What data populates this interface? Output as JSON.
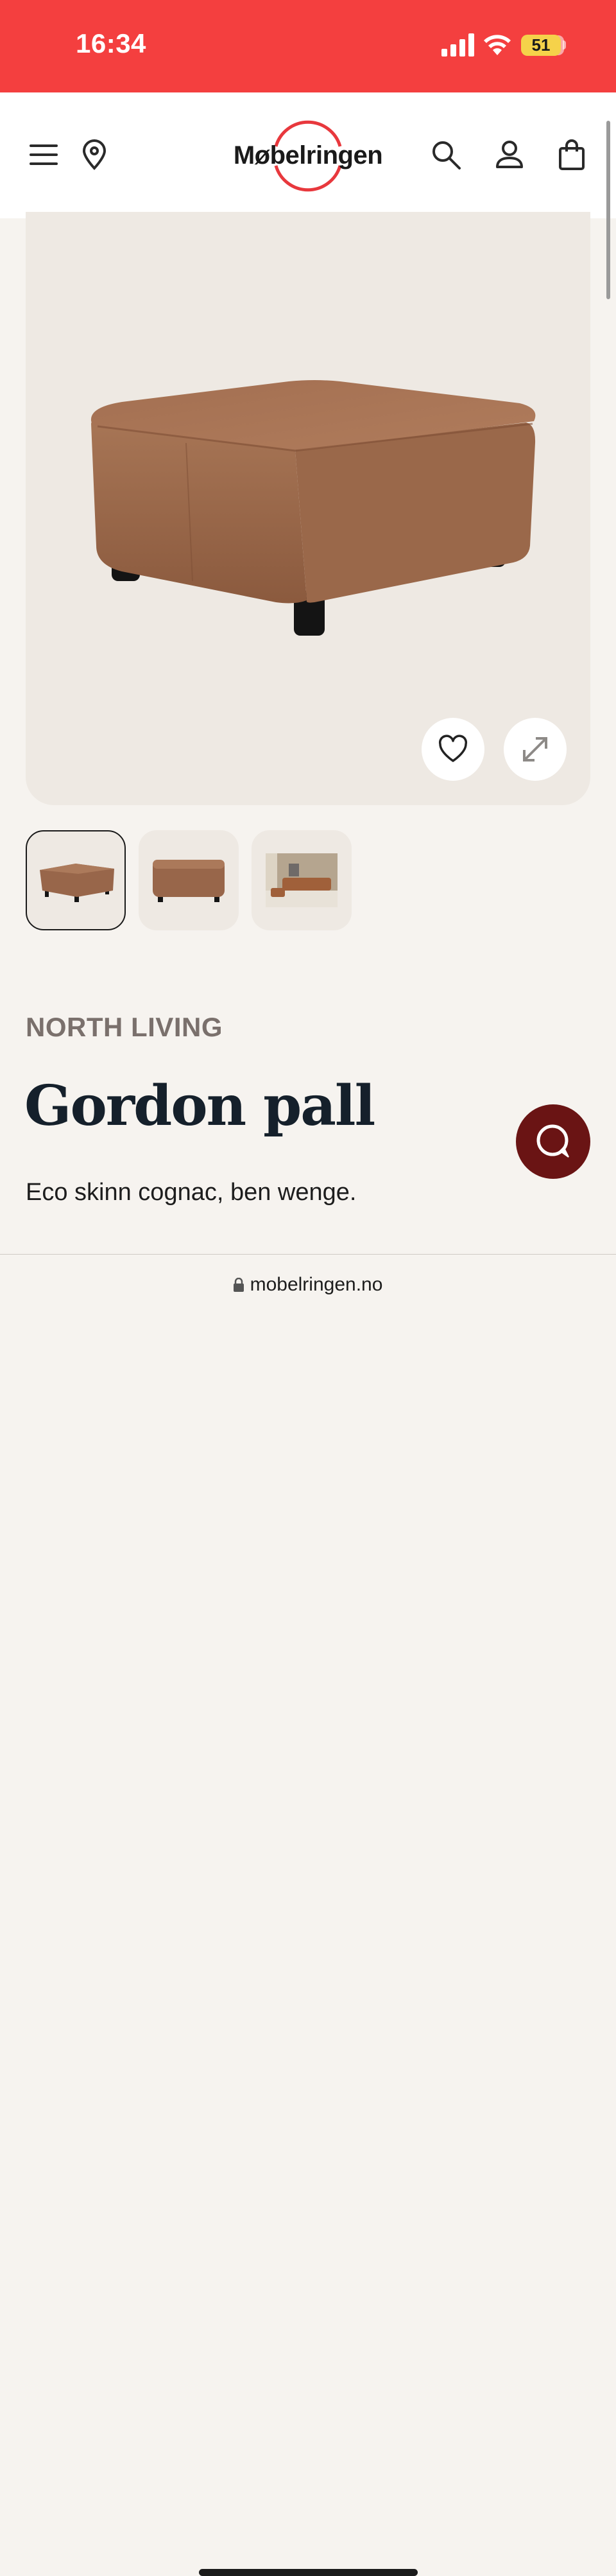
{
  "status_bar": {
    "time": "16:34",
    "battery": "51",
    "icons": [
      "signal-icon",
      "wifi-icon",
      "battery-icon"
    ],
    "background": "#f43f3f"
  },
  "header": {
    "logo": "Møbelringen",
    "icons": [
      "menu-icon",
      "location-pin-icon",
      "search-icon",
      "user-icon",
      "shopping-bag-icon"
    ]
  },
  "product": {
    "brand": "NORTH LIVING",
    "title": "Gordon pall",
    "description": "Eco skinn cognac, ben wenge.",
    "image_buttons": [
      "heart-icon",
      "expand-icon"
    ],
    "thumbnails": [
      "thumb-pouf-angle",
      "thumb-pouf-front",
      "thumb-living-room"
    ],
    "selected_thumbnail": 1
  },
  "chat": {
    "icon": "chat-icon",
    "color": "#6a1414"
  },
  "browser": {
    "url": "mobelringen.no"
  },
  "colors": {
    "accent": "#e8383d",
    "leather": "#9b6a4c"
  }
}
